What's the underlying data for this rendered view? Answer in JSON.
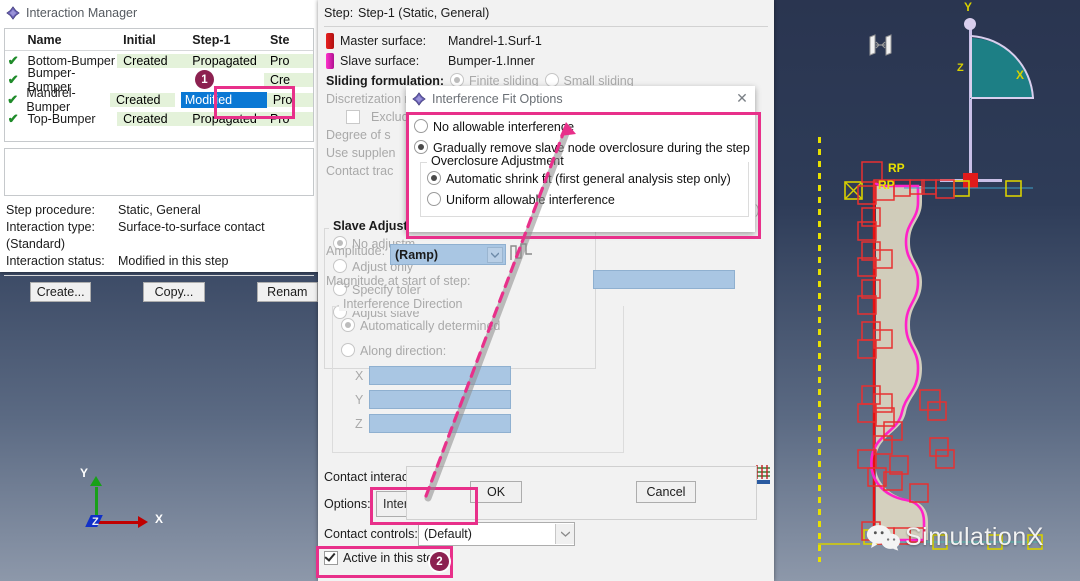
{
  "viewport": {
    "triad_small": {
      "x_label": "X",
      "y_label": "Y",
      "z_label": "Z"
    },
    "triad_large": {
      "x_label": "X",
      "y_label": "Y",
      "z_label": "Z"
    },
    "rp_label_1": "RP",
    "rp_label_2": "RP",
    "watermark": "SimulationX",
    "background_color": "#2b3a55",
    "part_fill_color": "#d9d4c0",
    "master_surface_color": "#e81010",
    "slave_surface_color": "#ff22c8"
  },
  "interaction_manager": {
    "title": "Interaction Manager",
    "icon": "abaqus-diamond-icon",
    "columns": [
      "",
      "Name",
      "Initial",
      "Step-1",
      "Ste"
    ],
    "rows": [
      {
        "check": "✔",
        "name": "Bottom-Bumper",
        "initial": "Created",
        "step1": "Propagated",
        "step2": "Pro",
        "step1_selected": false
      },
      {
        "check": "✔",
        "name": "Bumper-Bumper",
        "initial": "",
        "step1": "",
        "step2": "Cre",
        "step1_selected": false
      },
      {
        "check": "✔",
        "name": "Mandrel-Bumper",
        "initial": "Created",
        "step1": "Modified",
        "step2": "Pro",
        "step1_selected": true
      },
      {
        "check": "✔",
        "name": "Top-Bumper",
        "initial": "Created",
        "step1": "Propagated",
        "step2": "Pro",
        "step1_selected": false
      }
    ],
    "info": {
      "step_procedure_label": "Step procedure:",
      "step_procedure_value": "Static, General",
      "interaction_type_label": "Interaction type:",
      "interaction_type_value": "Surface-to-surface contact (Standard)",
      "interaction_status_label": "Interaction status:",
      "interaction_status_value": "Modified in this step"
    },
    "buttons": [
      "Create...",
      "Copy...",
      "Renam"
    ]
  },
  "edit_dialog": {
    "step_label": "Step:",
    "step_value": "Step-1 (Static, General)",
    "master_surface_label": "Master surface:",
    "master_surface_value": "Mandrel-1.Surf-1",
    "slave_surface_label": "Slave surface:",
    "slave_surface_value": "Bumper-1.Inner",
    "sliding_formulation_label": "Sliding formulation:",
    "sliding_finite": "Finite sliding",
    "sliding_small": "Small sliding",
    "discretization_label": "Discretization m",
    "exclude_label": "Exclude s",
    "degree_label": "Degree of s",
    "supplementary_label": "Use supplen",
    "contact_tracking_label": "Contact trac",
    "slave_adjustment_legend": "Slave Adjustme",
    "slave_options": [
      "No adjustm",
      "Adjust only",
      "Specify toler",
      "Adjust slave"
    ],
    "amplitude_label": "Amplitude:",
    "amplitude_value": "(Ramp)",
    "magnitude_label": "Magnitude at start of step:",
    "magnitude_value": "",
    "interference_direction_legend": "Interference Direction",
    "dir_auto": "Automatically determined",
    "dir_along": "Along direction:",
    "dir_x_label": "X",
    "dir_y_label": "Y",
    "dir_z_label": "Z",
    "dir_x_value": "",
    "dir_y_value": "",
    "dir_z_value": "",
    "right_edge_fragment": "te)",
    "contact_interaction_label": "Contact interacti",
    "options_label": "Options:",
    "options_value": "Interference Fit",
    "contact_controls_label": "Contact controls:",
    "contact_controls_value": "(Default)",
    "active_step_label": "Active in this step",
    "ok_button": "OK",
    "cancel_button": "Cancel"
  },
  "interference_dialog": {
    "title": "Interference Fit Options",
    "icon": "abaqus-diamond-icon",
    "close_icon": "close-icon",
    "option_none": "No allowable interference",
    "option_gradual": "Gradually remove slave node overclosure during the step",
    "overclosure_legend": "Overclosure Adjustment",
    "option_auto_shrink": "Automatic shrink fit (first general analysis step only)",
    "option_uniform": "Uniform allowable interference",
    "selected_main": "option_gradual",
    "selected_sub": "option_auto_shrink"
  },
  "annotations": {
    "badge_1": "1",
    "badge_2": "2",
    "highlight_color": "#e8308a"
  }
}
